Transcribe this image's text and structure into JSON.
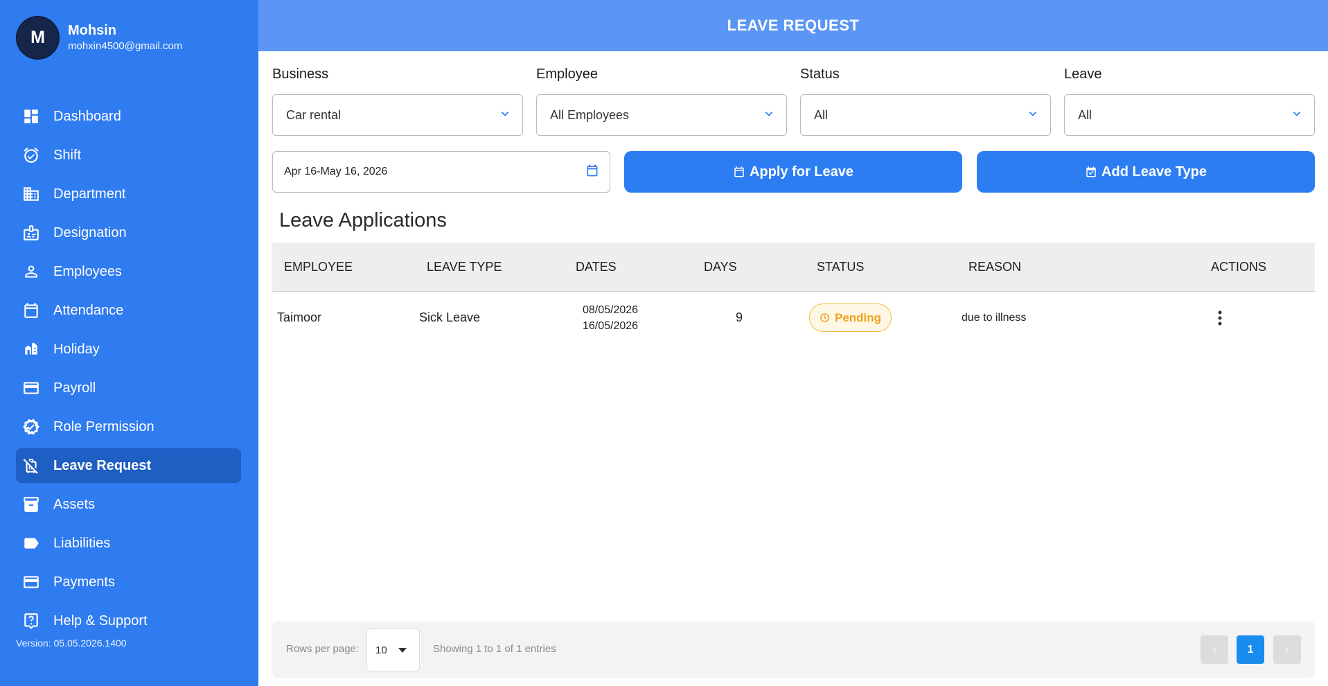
{
  "user": {
    "initial": "M",
    "name": "Mohsin",
    "email": "mohxin4500@gmail.com"
  },
  "sidebar": {
    "items": [
      {
        "label": "Dashboard",
        "icon": "dashboard-icon"
      },
      {
        "label": "Shift",
        "icon": "alarm-clock-icon"
      },
      {
        "label": "Department",
        "icon": "building-icon"
      },
      {
        "label": "Designation",
        "icon": "id-badge-icon"
      },
      {
        "label": "Employees",
        "icon": "person-icon"
      },
      {
        "label": "Attendance",
        "icon": "calendar-icon"
      },
      {
        "label": "Holiday",
        "icon": "holiday-building-icon"
      },
      {
        "label": "Payroll",
        "icon": "credit-card-icon"
      },
      {
        "label": "Role Permission",
        "icon": "verified-badge-icon"
      },
      {
        "label": "Leave Request",
        "icon": "luggage-off-icon",
        "active": true
      },
      {
        "label": "Assets",
        "icon": "archive-box-icon"
      },
      {
        "label": "Liabilities",
        "icon": "tag-label-icon"
      },
      {
        "label": "Payments",
        "icon": "credit-card-icon"
      },
      {
        "label": "Help & Support",
        "icon": "question-box-icon"
      }
    ],
    "version": "Version: 05.05.2026.1400"
  },
  "header": {
    "title": "LEAVE REQUEST"
  },
  "filters": {
    "business": {
      "label": "Business",
      "value": "Car rental"
    },
    "employee": {
      "label": "Employee",
      "value": "All Employees"
    },
    "status": {
      "label": "Status",
      "value": "All"
    },
    "leave": {
      "label": "Leave",
      "value": "All"
    },
    "date_range": "Apr 16-May 16, 2026"
  },
  "actions": {
    "apply_label": "Apply for Leave",
    "add_type_label": "Add Leave Type"
  },
  "section_title": "Leave Applications",
  "table": {
    "columns": [
      "EMPLOYEE",
      "LEAVE TYPE",
      "DATES",
      "DAYS",
      "STATUS",
      "REASON",
      "ACTIONS"
    ],
    "rows": [
      {
        "employee": "Taimoor",
        "leave_type": "Sick Leave",
        "date_from": "08/05/2026",
        "date_to": "16/05/2026",
        "days": "9",
        "status": "Pending",
        "reason": "due to illness"
      }
    ]
  },
  "pagination": {
    "rows_label": "Rows per page:",
    "rows_per_page": "10",
    "showing": "Showing 1 to 1 of 1 entries",
    "current_page": "1",
    "prev": "‹",
    "next": "›"
  },
  "colors": {
    "sidebar_bg": "#2f7bf0",
    "header_bg": "#5b96f5",
    "primary_button": "#2d7df2",
    "pending_badge": "#f0a21e"
  }
}
